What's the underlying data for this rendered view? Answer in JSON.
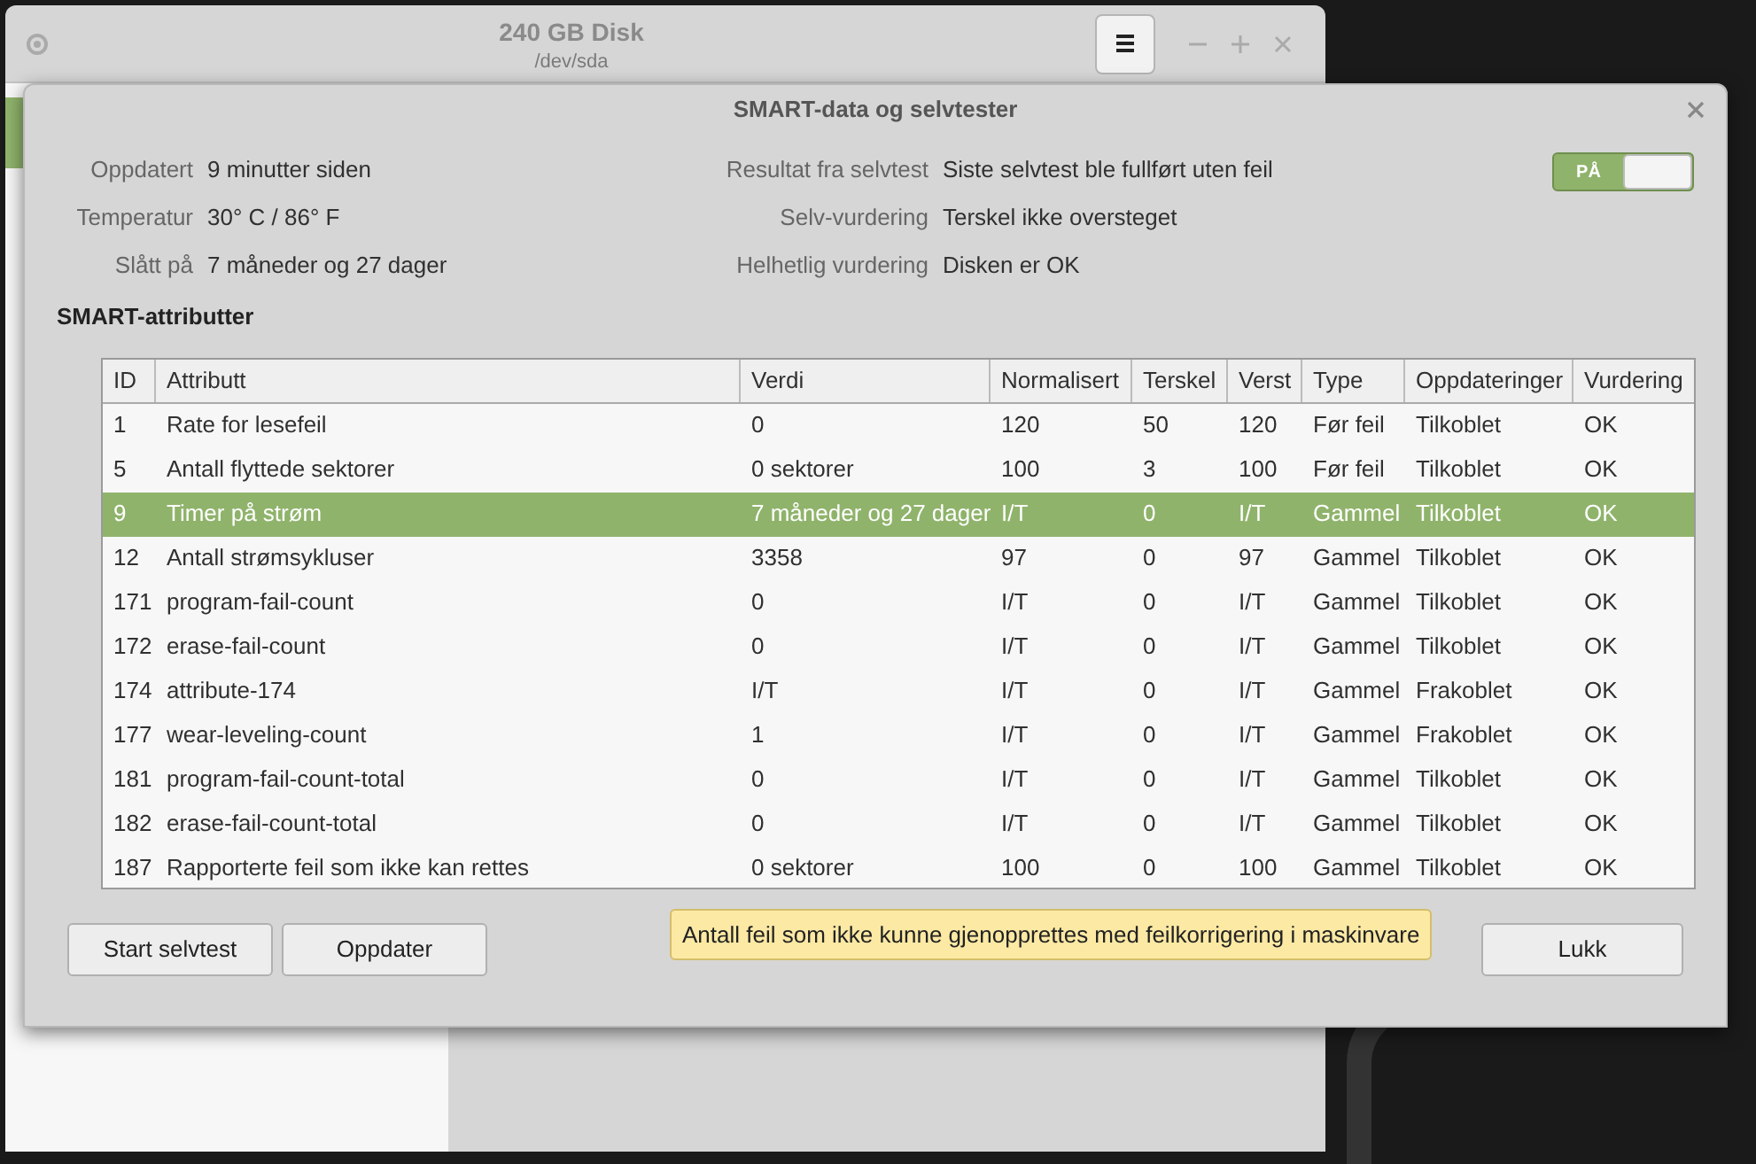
{
  "back_window": {
    "title": "240 GB Disk",
    "subtitle": "/dev/sda"
  },
  "dialog": {
    "title": "SMART-data og selvtester",
    "info_left": [
      {
        "label": "Oppdatert",
        "value": "9 minutter siden"
      },
      {
        "label": "Temperatur",
        "value": "30° C / 86° F"
      },
      {
        "label": "Slått på",
        "value": "7 måneder og 27 dager"
      }
    ],
    "info_right": [
      {
        "label": "Resultat fra selvtest",
        "value": "Siste selvtest ble fullført uten feil"
      },
      {
        "label": "Selv-vurdering",
        "value": "Terskel ikke oversteget"
      },
      {
        "label": "Helhetlig vurdering",
        "value": "Disken er OK"
      }
    ],
    "switch": {
      "label": "PÅ",
      "on": true
    },
    "section_title": "SMART-attributter",
    "table": {
      "columns": [
        "ID",
        "Attributt",
        "Verdi",
        "Normalisert",
        "Terskel",
        "Verst",
        "Type",
        "Oppdateringer",
        "Vurdering"
      ],
      "rows": [
        {
          "cells": [
            "1",
            "Rate for lesefeil",
            "0",
            "120",
            "50",
            "120",
            "Før feil",
            "Tilkoblet",
            "OK"
          ],
          "selected": false
        },
        {
          "cells": [
            "5",
            "Antall flyttede sektorer",
            "0 sektorer",
            "100",
            "3",
            "100",
            "Før feil",
            "Tilkoblet",
            "OK"
          ],
          "selected": false
        },
        {
          "cells": [
            "9",
            "Timer på strøm",
            "7 måneder og 27 dager",
            "I/T",
            "0",
            "I/T",
            "Gammel",
            "Tilkoblet",
            "OK"
          ],
          "selected": true
        },
        {
          "cells": [
            "12",
            "Antall strømsykluser",
            "3358",
            "97",
            "0",
            "97",
            "Gammel",
            "Tilkoblet",
            "OK"
          ],
          "selected": false
        },
        {
          "cells": [
            "171",
            "program-fail-count",
            "0",
            "I/T",
            "0",
            "I/T",
            "Gammel",
            "Tilkoblet",
            "OK"
          ],
          "selected": false
        },
        {
          "cells": [
            "172",
            "erase-fail-count",
            "0",
            "I/T",
            "0",
            "I/T",
            "Gammel",
            "Tilkoblet",
            "OK"
          ],
          "selected": false
        },
        {
          "cells": [
            "174",
            "attribute-174",
            "I/T",
            "I/T",
            "0",
            "I/T",
            "Gammel",
            "Frakoblet",
            "OK"
          ],
          "selected": false
        },
        {
          "cells": [
            "177",
            "wear-leveling-count",
            "1",
            "I/T",
            "0",
            "I/T",
            "Gammel",
            "Frakoblet",
            "OK"
          ],
          "selected": false
        },
        {
          "cells": [
            "181",
            "program-fail-count-total",
            "0",
            "I/T",
            "0",
            "I/T",
            "Gammel",
            "Tilkoblet",
            "OK"
          ],
          "selected": false
        },
        {
          "cells": [
            "182",
            "erase-fail-count-total",
            "0",
            "I/T",
            "0",
            "I/T",
            "Gammel",
            "Tilkoblet",
            "OK"
          ],
          "selected": false
        },
        {
          "cells": [
            "187",
            "Rapporterte feil som ikke kan rettes",
            "0 sektorer",
            "100",
            "0",
            "100",
            "Gammel",
            "Tilkoblet",
            "OK"
          ],
          "selected": false
        }
      ]
    },
    "tooltip": "Antall feil som ikke kunne gjenopprettes med feilkorrigering i maskinvare",
    "buttons_left": [
      "Start selvtest",
      "Oppdater"
    ],
    "buttons_right": [
      "Lukk"
    ]
  }
}
